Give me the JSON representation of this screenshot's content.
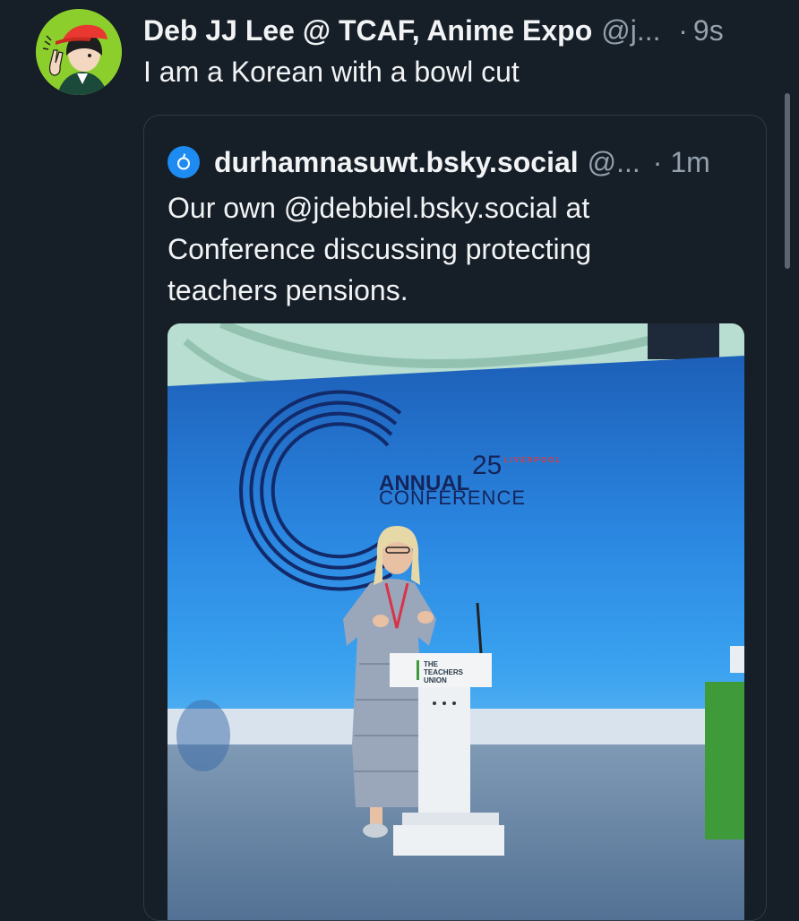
{
  "post": {
    "display_name": "Deb JJ Lee @ TCAF, Anime Expo",
    "handle": "@j...",
    "dot": "·",
    "time": "9s",
    "text": "I am a Korean with a bowl cut",
    "avatar_icon": "cartoon-avatar-icon"
  },
  "quote": {
    "display_name": "durhamnasuwt.bsky.social",
    "handle": "@...",
    "time": "· 1m",
    "text": "Our own @jdebbiel.bsky.social at Conference discussing protecting teachers pensions.",
    "avatar_icon": "apple-logo-icon",
    "image": {
      "icon": "conference-photo",
      "banner_number": "25",
      "banner_city": "LIVERPOOL",
      "banner_line1": "ANNUAL",
      "banner_line2": "CONFERENCE",
      "podium_line1": "THE",
      "podium_line2": "TEACHERS",
      "podium_line3": "UNION"
    }
  },
  "colors": {
    "background": "#161e27",
    "text": "#f1f3f5",
    "muted": "#93a0ad",
    "card_border": "#2e3a47",
    "accent_blue": "#1d8bf1"
  }
}
